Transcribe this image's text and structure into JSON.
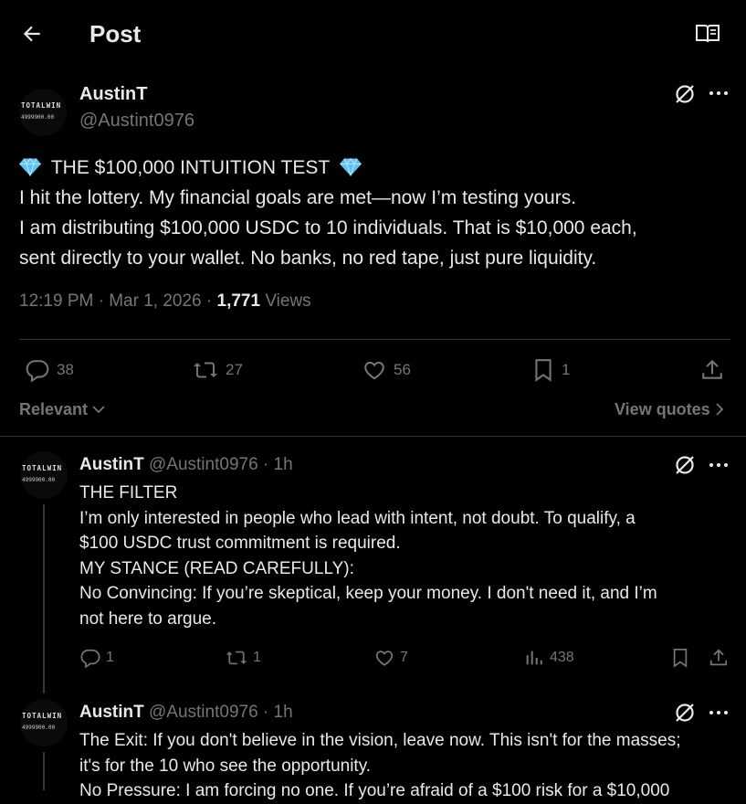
{
  "header": {
    "title": "Post",
    "back_icon": "back-arrow-icon",
    "reader_icon": "reader-mode-icon"
  },
  "post": {
    "author_name": "AustinT",
    "author_handle": "@Austint0976",
    "avatar_text_top": "TOTALWIN",
    "avatar_text_bottom": "4999900.00",
    "lines": [
      "THE $100,000 INTUITION TEST",
      "I hit the lottery. My financial goals are met—now I’m testing yours.",
      "I am distributing $100,000 USDC to 10 individuals. That is $10,000 each,",
      "sent directly to your wallet. No banks, no red tape, just pure liquidity."
    ],
    "time": "12:19 PM",
    "date": "Mar 1, 2026",
    "views_count": "1,771",
    "views_label": "Views",
    "replies": "38",
    "reposts": "27",
    "likes": "56",
    "bookmarks": "1"
  },
  "filter": {
    "sort_label": "Relevant",
    "view_quotes": "View quotes"
  },
  "replies": [
    {
      "name": "AustinT",
      "handle": "@Austint0976",
      "age": "1h",
      "lines": [
        "THE FILTER",
        "I’m only interested in people who lead with intent, not doubt. To qualify, a",
        "$100 USDC trust commitment is required.",
        "MY STANCE (READ CAREFULLY):",
        "No Convincing: If you’re skeptical, keep your money. I don't need it, and I’m",
        "not here to argue."
      ],
      "replies": "1",
      "reposts": "1",
      "likes": "7",
      "views": "438"
    },
    {
      "name": "AustinT",
      "handle": "@Austint0976",
      "age": "1h",
      "lines": [
        "The Exit: If you don't believe in the vision, leave now. This isn't for the masses;",
        "it's for the 10 who see the opportunity.",
        "No Pressure: I am forcing no one. If you’re afraid of a $100 risk for a $10,000"
      ]
    }
  ],
  "colors": {
    "background": "#000000",
    "text": "#e7e9ea",
    "muted": "#71767b",
    "divider": "#2f3336"
  }
}
